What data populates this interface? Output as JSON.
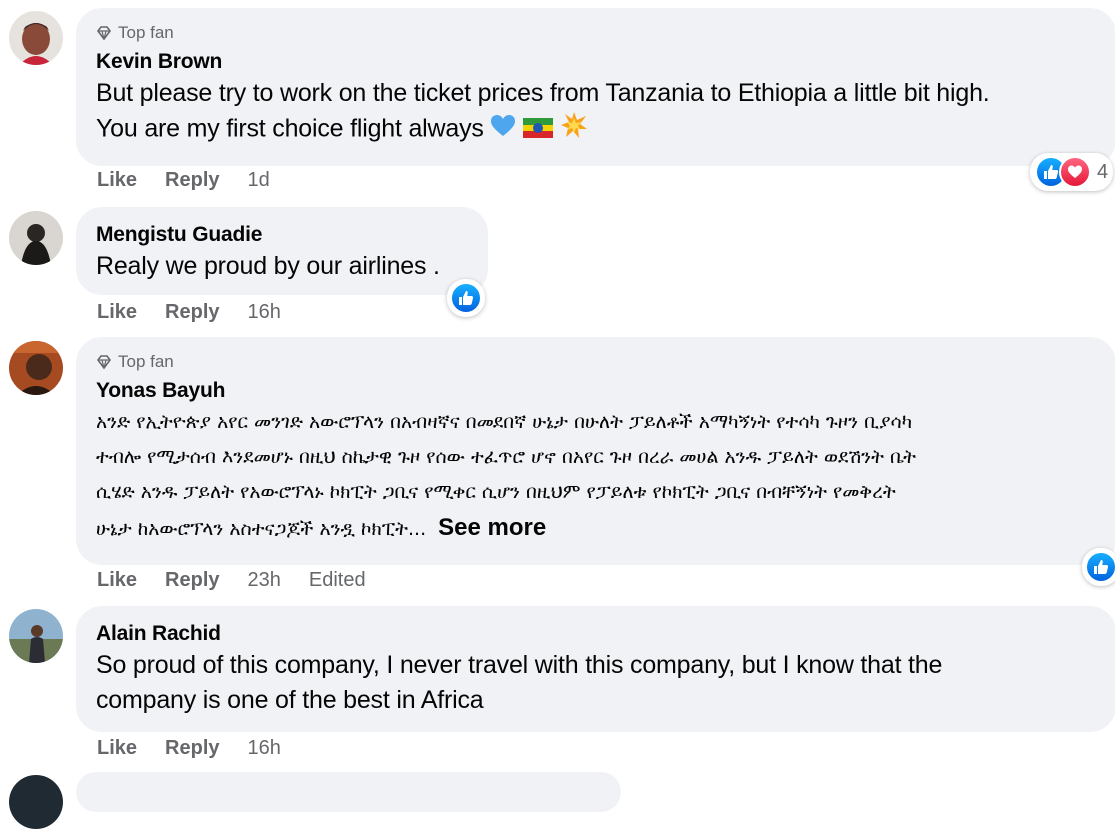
{
  "comments": [
    {
      "badge": "Top fan",
      "author": "Kevin Brown",
      "lines": [
        "But please try to work on the ticket prices from Tanzania to Ethiopia a little bit high.",
        "You are my first choice flight always"
      ],
      "actions": {
        "like": "Like",
        "reply": "Reply",
        "time": "1d"
      },
      "reactions": {
        "types": [
          "like-icon",
          "love-icon"
        ],
        "count": "4"
      }
    },
    {
      "author": "Mengistu Guadie",
      "lines": [
        "Realy we proud by our airlines ."
      ],
      "actions": {
        "like": "Like",
        "reply": "Reply",
        "time": "16h"
      },
      "reactions": {
        "types": [
          "like-icon"
        ]
      }
    },
    {
      "badge": "Top fan",
      "author": "Yonas Bayuh",
      "lines": [
        "አንድ የኢትዮጵያ አየር መንገድ አውሮፕላን በአብዛኛና በመደበኛ ሁኔታ በሁለት ፓይለቶች አማካኝነት የተሳካ ጉዞን ቢያሳካ",
        "ተብሎ የሚታሰብ እንደመሆኑ በዚህ ስኬታዊ ጉዞ የሰው ተፈጥሮ ሆኖ በአየር ጉዞ በረራ መሀል አንዱ ፓይለት ወደሽንት ቤት",
        "ሲሄድ አንዱ ፓይለት የአውሮፕላኑ ኮክፒት ጋቢና የሚቀር ሲሆን በዚህም የፓይለቱ የኮክፒት ጋቢና በብቸኝነት የመቅረት",
        "ሁኔታ ከአውሮፕላን አስተናጋጆች አንዷ ኮክፒት..."
      ],
      "see_more": "See more",
      "actions": {
        "like": "Like",
        "reply": "Reply",
        "time": "23h",
        "edited": "Edited"
      },
      "reactions": {
        "types": [
          "like-icon"
        ]
      }
    },
    {
      "author": "Alain Rachid",
      "lines": [
        "So proud of this company, I never travel with this company, but I know that the",
        "company is one of the best in Africa"
      ],
      "actions": {
        "like": "Like",
        "reply": "Reply",
        "time": "16h"
      }
    }
  ],
  "colors": {
    "bubble": "#f0f2f5",
    "meta_text": "#65676b",
    "like_blue": "#0866ff",
    "love_red": "#f33e58"
  }
}
